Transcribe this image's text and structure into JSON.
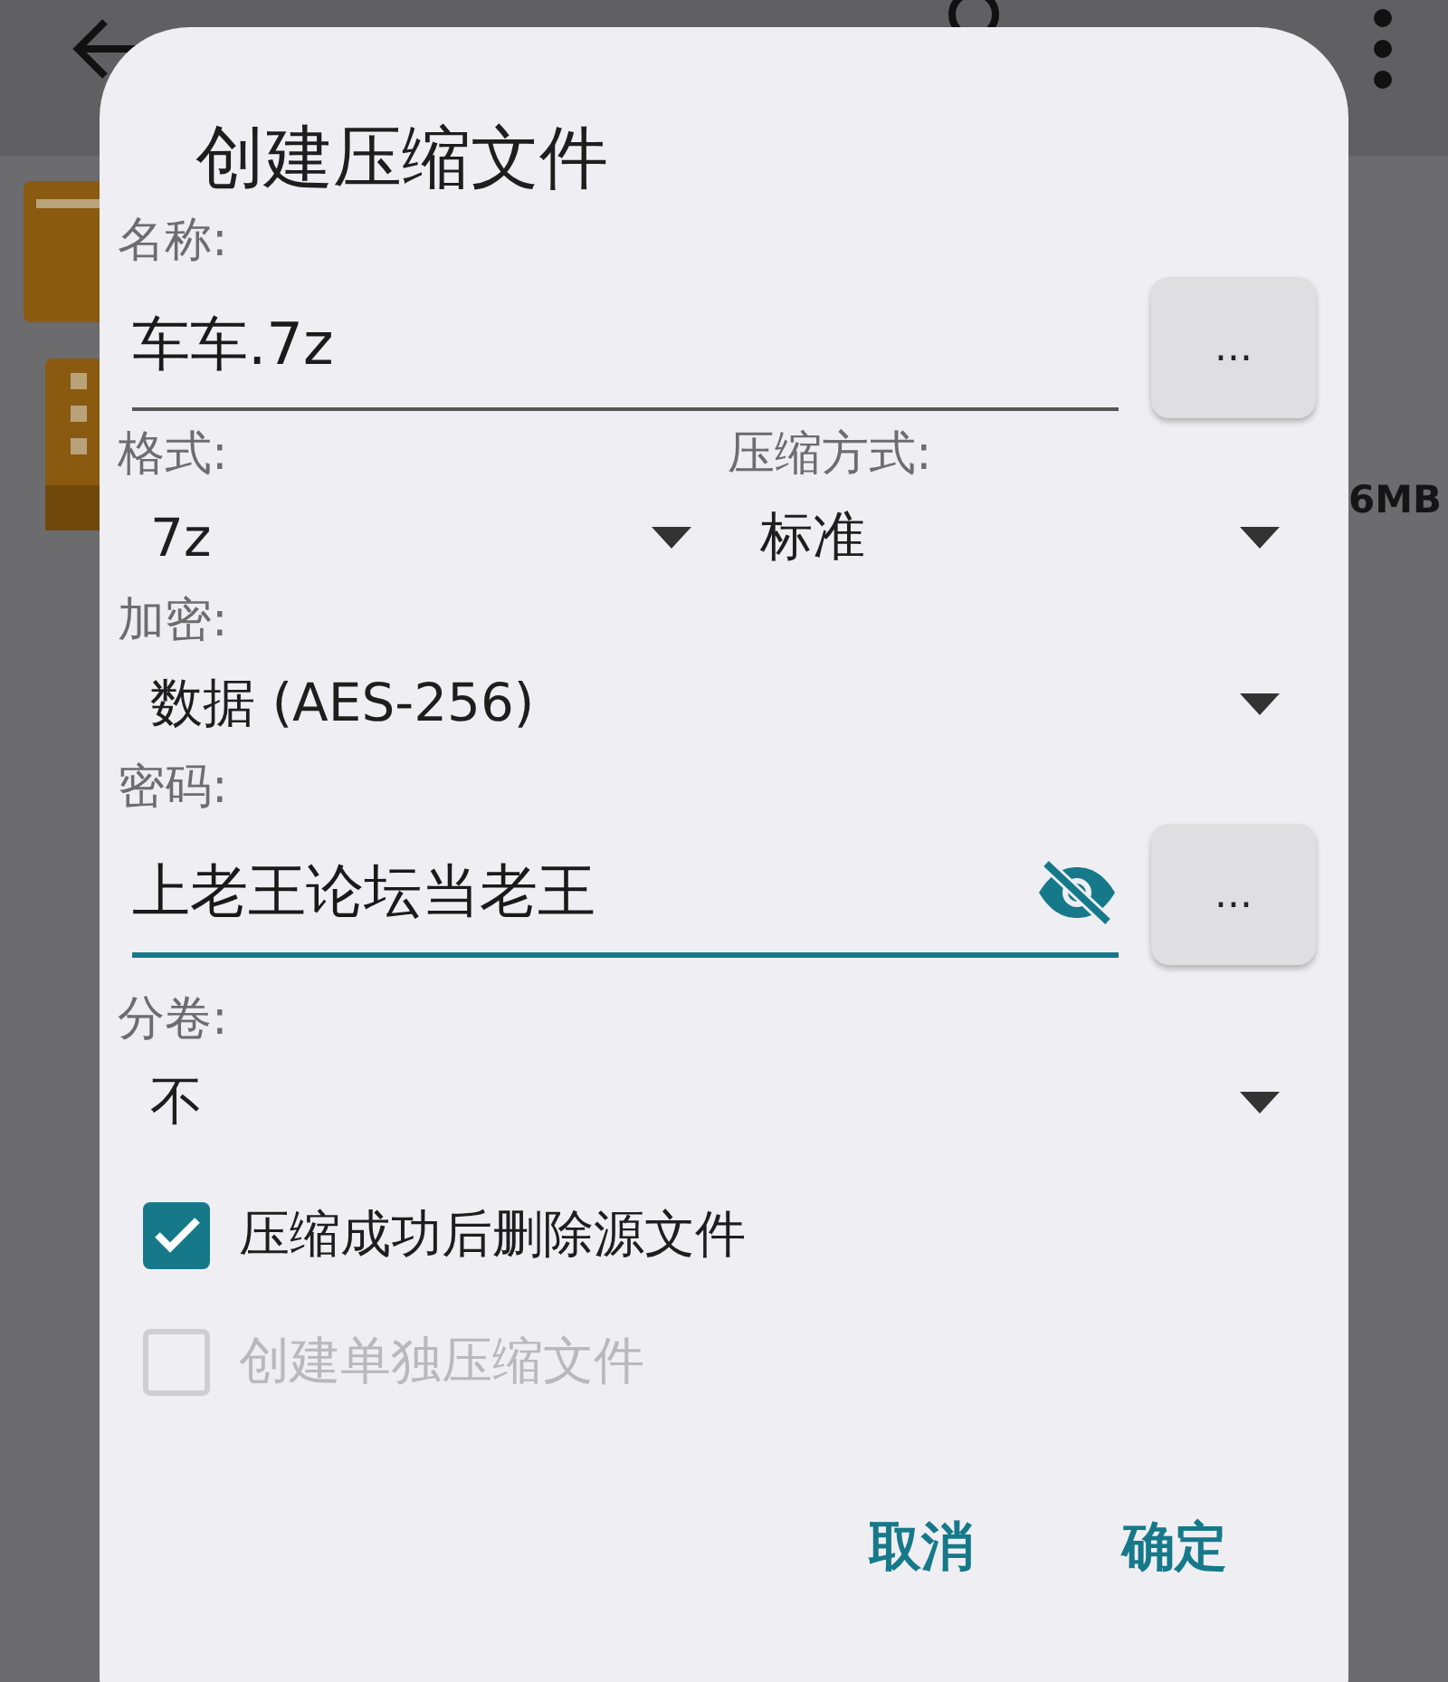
{
  "background": {
    "size_text": "6MB"
  },
  "dialog": {
    "title": "创建压缩文件",
    "name": {
      "label": "名称:",
      "value": "车车.7z",
      "browse": "..."
    },
    "format": {
      "label": "格式:",
      "value": "7z"
    },
    "method": {
      "label": "压缩方式:",
      "value": "标准"
    },
    "encryption": {
      "label": "加密:",
      "value": "数据 (AES-256)"
    },
    "password": {
      "label": "密码:",
      "value": "上老王论坛当老王",
      "focused": true,
      "browse": "..."
    },
    "split": {
      "label": "分卷:",
      "value": "不"
    },
    "options": [
      {
        "label": "压缩成功后删除源文件",
        "checked": true,
        "disabled": false
      },
      {
        "label": "创建单独压缩文件",
        "checked": false,
        "disabled": true
      }
    ],
    "buttons": [
      "取消",
      "确定"
    ]
  }
}
